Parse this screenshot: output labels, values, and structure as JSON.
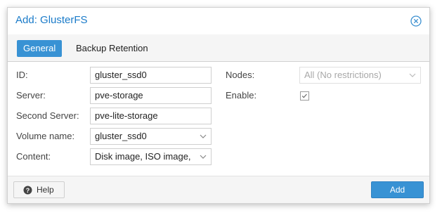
{
  "dialog": {
    "title": "Add: GlusterFS",
    "close_icon": "close-circle-icon"
  },
  "tabs": [
    {
      "label": "General",
      "active": true
    },
    {
      "label": "Backup Retention",
      "active": false
    }
  ],
  "form": {
    "id": {
      "label": "ID:",
      "value": "gluster_ssd0"
    },
    "server": {
      "label": "Server:",
      "value": "pve-storage"
    },
    "second_server": {
      "label": "Second Server:",
      "value": "pve-lite-storage"
    },
    "volume_name": {
      "label": "Volume name:",
      "value": "gluster_ssd0"
    },
    "content": {
      "label": "Content:",
      "value": "Disk image, ISO image, "
    },
    "nodes": {
      "label": "Nodes:",
      "value": "All (No restrictions)",
      "disabled": true
    },
    "enable": {
      "label": "Enable:",
      "checked": true
    }
  },
  "footer": {
    "help_label": "Help",
    "help_icon": "question-circle-icon",
    "add_label": "Add"
  },
  "colors": {
    "accent": "#3892d4",
    "title": "#1a7bc9"
  }
}
